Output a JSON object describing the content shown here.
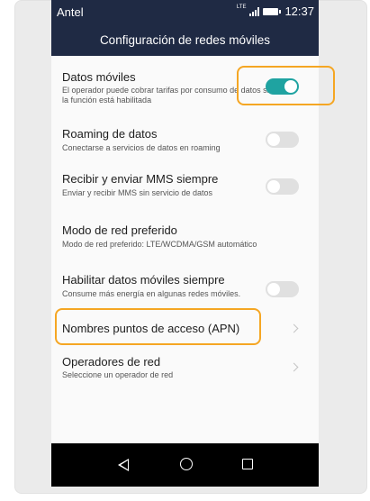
{
  "statusbar": {
    "carrier": "Antel",
    "network": "LTE",
    "time": "12:37"
  },
  "header": {
    "title": "Configuración de redes móviles"
  },
  "settings": [
    {
      "title": "Datos móviles",
      "subtitle": "El operador puede cobrar tarifas por consumo de datos si la función está habilitada",
      "control": "toggle",
      "enabled": true
    },
    {
      "title": "Roaming de datos",
      "subtitle": "Conectarse a servicios de datos en roaming",
      "control": "toggle",
      "enabled": false
    },
    {
      "title": "Recibir y enviar MMS siempre",
      "subtitle": "Enviar y recibir MMS sin servicio de datos",
      "control": "toggle",
      "enabled": false
    },
    {
      "title": "Modo de red preferido",
      "subtitle": "Modo de red preferido: LTE/WCDMA/GSM automático",
      "control": "none"
    },
    {
      "title": "Habilitar datos móviles siempre",
      "subtitle": "Consume más energía en algunas redes móviles.",
      "control": "toggle",
      "enabled": false
    },
    {
      "title": "Nombres puntos de acceso (APN)",
      "subtitle": "",
      "control": "chevron"
    },
    {
      "title": "Operadores de red",
      "subtitle": "Seleccione un operador de red",
      "control": "chevron"
    }
  ],
  "navbar": {
    "icons": [
      "back-icon",
      "home-icon",
      "recent-apps-icon"
    ]
  },
  "colors": {
    "header": "#1f2a44",
    "toggle_on": "#1fa3a1",
    "highlight": "#f5a623"
  }
}
